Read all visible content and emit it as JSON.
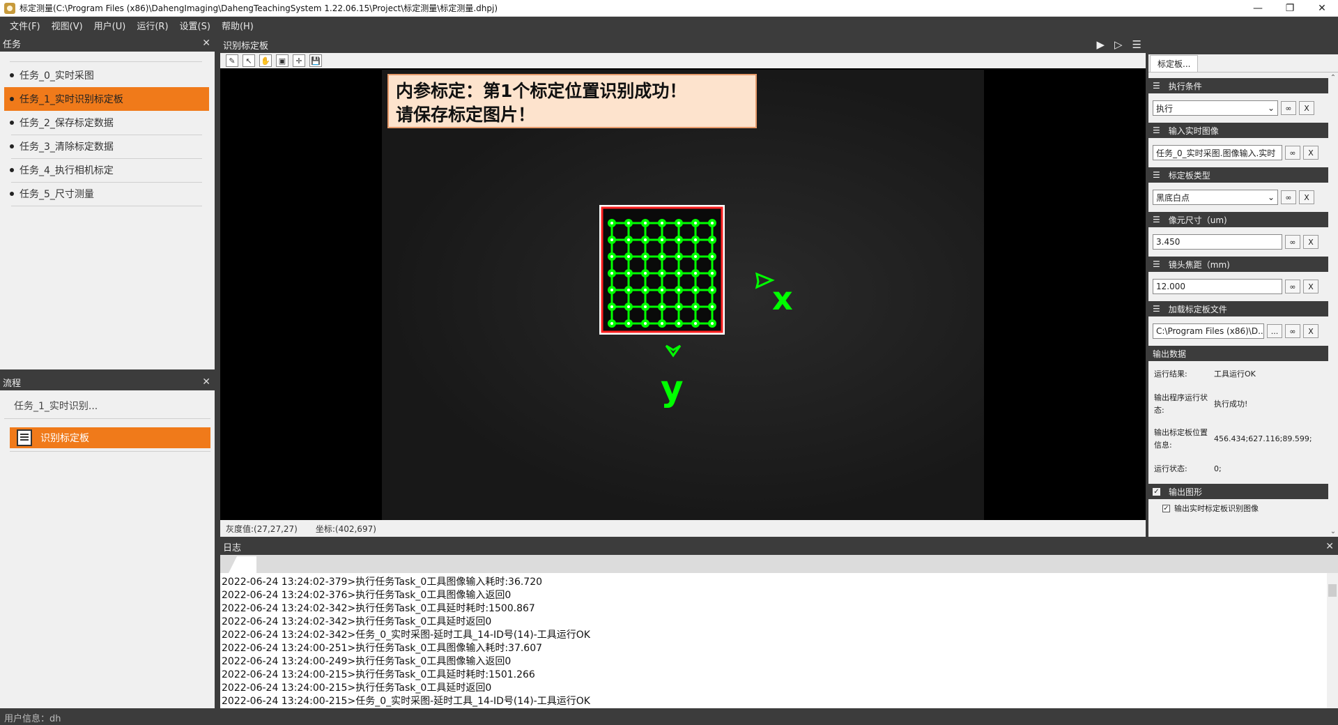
{
  "window": {
    "title": "标定测量(C:\\Program Files (x86)\\DahengImaging\\DahengTeachingSystem 1.22.06.15\\Project\\标定测量\\标定测量.dhpj)",
    "minimize": "—",
    "restore": "❐",
    "close": "✕"
  },
  "menu": [
    {
      "label": "文件(F)"
    },
    {
      "label": "视图(V)"
    },
    {
      "label": "用户(U)"
    },
    {
      "label": "运行(R)"
    },
    {
      "label": "设置(S)"
    },
    {
      "label": "帮助(H)"
    }
  ],
  "task_panel": {
    "title": "任务",
    "items": [
      {
        "label": "任务_0_实时采图",
        "active": false
      },
      {
        "label": "任务_1_实时识别标定板",
        "active": true
      },
      {
        "label": "任务_2_保存标定数据",
        "active": false
      },
      {
        "label": "任务_3_清除标定数据",
        "active": false
      },
      {
        "label": "任务_4_执行相机标定",
        "active": false
      },
      {
        "label": "任务_5_尺寸测量",
        "active": false
      }
    ]
  },
  "flow_panel": {
    "title": "流程",
    "task_name": "任务_1_实时识别...",
    "node_label": "识别标定板"
  },
  "image_panel": {
    "title": "识别标定板",
    "banner_line1": "内参标定：第1个标定位置识别成功！",
    "banner_line2": "请保存标定图片！",
    "axis_x": "x",
    "axis_y": "y",
    "gray_value": "灰度值:(27,27,27)",
    "coordinate": "坐标:(402,697)",
    "grid_rows": 7,
    "grid_cols": 7,
    "grid_color": "#00ff00"
  },
  "param_panel": {
    "tab": "标定板...",
    "sections": [
      {
        "title": "执行条件",
        "value": "执行",
        "type": "select"
      },
      {
        "title": "输入实时图像",
        "value": "任务_0_实时采图.图像输入.实时",
        "type": "text"
      },
      {
        "title": "标定板类型",
        "value": "黑底白点",
        "type": "select"
      },
      {
        "title": "像元尺寸（um)",
        "value": "3.450",
        "type": "text"
      },
      {
        "title": "镜头焦距（mm)",
        "value": "12.000",
        "type": "text"
      },
      {
        "title": "加载标定板文件",
        "value": "C:\\Program Files (x86)\\D...",
        "type": "file"
      }
    ],
    "btn_link": "∞",
    "btn_clear": "X",
    "btn_browse": "...",
    "output_title": "输出数据",
    "outputs": [
      {
        "label": "运行结果:",
        "value": "工具运行OK"
      },
      {
        "label": "输出程序运行状态:",
        "value": "执行成功!"
      },
      {
        "label": "输出标定板位置信息:",
        "value": "456.434;627.116;89.599;"
      },
      {
        "label": "运行状态:",
        "value": "0;"
      }
    ],
    "graphics_title": "输出图形",
    "graphics_option": "输出实时标定板识别图像"
  },
  "log_panel": {
    "title": "日志",
    "lines": [
      "2022-06-24 13:24:02-379>执行任务Task_0工具图像输入耗时:36.720",
      "2022-06-24 13:24:02-376>执行任务Task_0工具图像输入返回0",
      "2022-06-24 13:24:02-342>执行任务Task_0工具延时耗时:1500.867",
      "2022-06-24 13:24:02-342>执行任务Task_0工具延时返回0",
      "2022-06-24 13:24:02-342>任务_0_实时采图-延时工具_14-ID号(14)-工具运行OK",
      "2022-06-24 13:24:00-251>执行任务Task_0工具图像输入耗时:37.607",
      "2022-06-24 13:24:00-249>执行任务Task_0工具图像输入返回0",
      "2022-06-24 13:24:00-215>执行任务Task_0工具延时耗时:1501.266",
      "2022-06-24 13:24:00-215>执行任务Task_0工具延时返回0",
      "2022-06-24 13:24:00-215>任务_0_实时采图-延时工具_14-ID号(14)-工具运行OK"
    ]
  },
  "status_bar": {
    "user_info": "用户信息：dh"
  },
  "colors": {
    "accent": "#f07a1a",
    "dark": "#3c3c3c",
    "detect": "#00ff00"
  }
}
